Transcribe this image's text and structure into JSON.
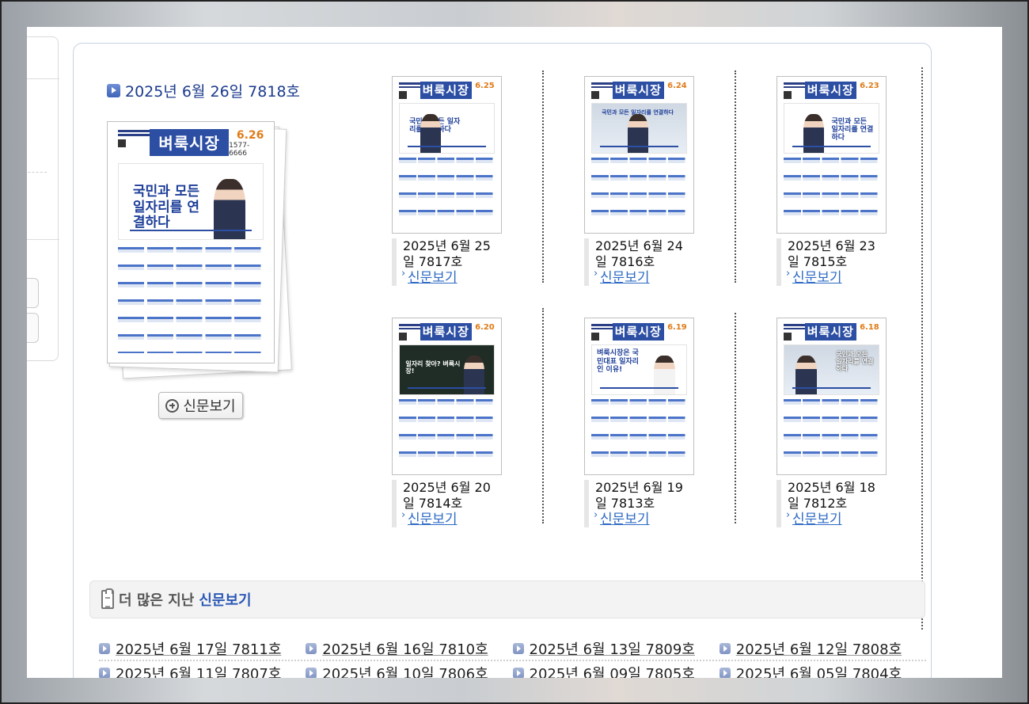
{
  "featured": {
    "title": "2025년 6월 26일 7818호",
    "view_label": "신문보기",
    "paper": {
      "brand": "벼룩시장",
      "date": "6.26",
      "phone": "1577-6666",
      "headline": "국민과 모든 일자리를 연결하다"
    }
  },
  "issues": [
    {
      "caption": "2025년 6월 25일 7817호",
      "link": "신문보기",
      "brand": "벼룩시장",
      "date": "6.25",
      "headline": "국민과 모든 일자리를 연결하다",
      "style": "light"
    },
    {
      "caption": "2025년 6월 24일 7816호",
      "link": "신문보기",
      "brand": "벼룩시장",
      "date": "6.24",
      "headline": "국민과 모든 일자리를 연결하다",
      "style": "light"
    },
    {
      "caption": "2025년 6월 23일 7815호",
      "link": "신문보기",
      "brand": "벼룩시장",
      "date": "6.23",
      "headline": "국민과 모든 일자리를 연결하다",
      "style": "light"
    },
    {
      "caption": "2025년 6월 20일 7814호",
      "link": "신문보기",
      "brand": "벼룩시장",
      "date": "6.20",
      "headline": "일자리 찾아? 벼룩시장!",
      "style": "dark"
    },
    {
      "caption": "2025년 6월 19일 7813호",
      "link": "신문보기",
      "brand": "벼룩시장",
      "date": "6.19",
      "headline": "벼룩시장은 국민대표 일자리인 이유!",
      "style": "white"
    },
    {
      "caption": "2025년 6월 18일 7812호",
      "link": "신문보기",
      "brand": "벼룩시장",
      "date": "6.18",
      "headline": "국민과 모든 일자리를 연결하다",
      "style": "photo"
    }
  ],
  "more": {
    "prefix": "더 많은 지난",
    "accent": "신문보기"
  },
  "archive": {
    "row1": [
      "2025년 6월 17일 7811호",
      "2025년 6월 16일 7810호",
      "2025년 6월 13일 7809호",
      "2025년 6월 12일 7808호"
    ],
    "row2": [
      "2025년 6월 11일 7807호",
      "2025년 6월 10일 7806호",
      "2025년 6월 09일 7805호",
      "2025년 6월 05일 7804호"
    ]
  },
  "colors": {
    "title_blue": "#1c3b8c",
    "link_blue": "#2f6bc4",
    "brand_blue": "#2c4ea3",
    "date_orange": "#e07c1a"
  }
}
